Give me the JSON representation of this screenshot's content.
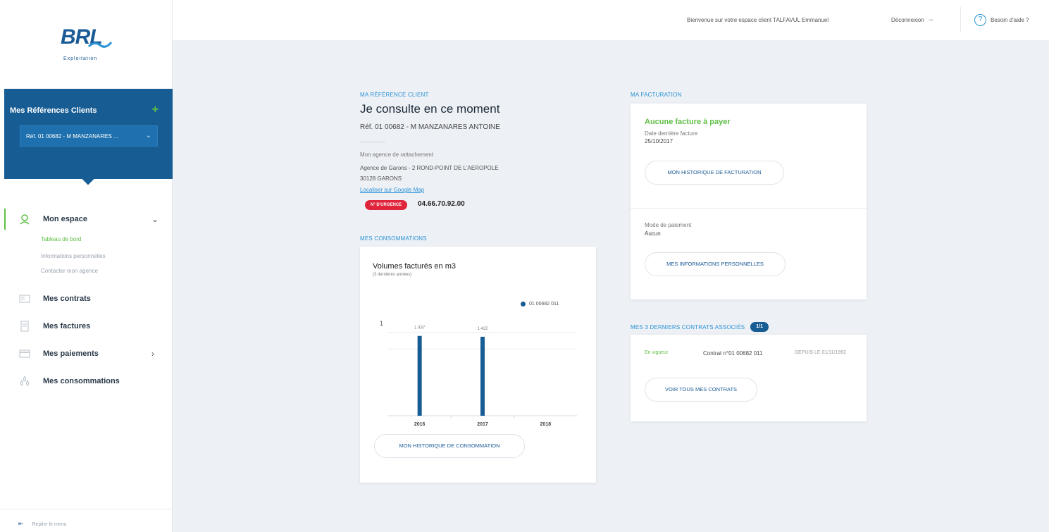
{
  "brand": {
    "logo_text": "BRL",
    "logo_sub": "Exploitation",
    "brand_blue": "#175d94",
    "accent_green": "#5fbf45",
    "accent_light_blue": "#2a93d5",
    "alert_red": "#e0243c"
  },
  "header": {
    "welcome": "Bienvenue sur votre espace client TALFAVUL Emmanuel",
    "logout": "Déconnexion",
    "help": "Besoin d'aide ?"
  },
  "sidebar": {
    "refs_title": "Mes Références Clients",
    "refs_add": "+",
    "refs_selected": "Réf. 01 00682 - M MANZANARES ...",
    "nav": [
      {
        "label": "Mon espace",
        "icon": "user-pin-icon"
      },
      {
        "label": "Mes contrats",
        "icon": "contract-icon"
      },
      {
        "label": "Mes factures",
        "icon": "invoice-icon"
      },
      {
        "label": "Mes paiements",
        "icon": "card-icon"
      },
      {
        "label": "Mes consommations",
        "icon": "drops-icon"
      }
    ],
    "subnav": [
      "Tableau de bord",
      "Informations personnelles",
      "Contacter mon agence"
    ],
    "collapse": "Replier le menu"
  },
  "client": {
    "section": "MA RÉFÉRENCE CLIENT",
    "heading": "Je consulte en ce moment",
    "ref": "Réf. 01 00682 - M MANZANARES ANTOINE",
    "agency_label": "Mon agence de rattachement",
    "agency_line1": "Agence de Garons - 2 ROND-POINT DE L'AEROPOLE",
    "agency_line2": "30128 GARONS",
    "agency_link": "Localiser sur Google Map",
    "urgence_label": "N° D'URGENCE",
    "urgence_number": "04.66.70.92.00"
  },
  "consumption": {
    "section": "MES CONSOMMATIONS",
    "title": "Volumes facturés en m3",
    "subtitle": "(3 dernières années)",
    "legend": "01 00682 011",
    "button": "MON HISTORIQUE DE CONSOMMATION"
  },
  "billing": {
    "section": "MA FACTURATION",
    "none": "Aucune facture à payer",
    "last_label": "Date dernière facture",
    "last_date": "25/10/2017",
    "history_button": "MON HISTORIQUE DE FACTURATION",
    "pay_label": "Mode de paiement",
    "pay_value": "Aucun",
    "info_button": "MES INFORMATIONS PERSONNELLES"
  },
  "contracts": {
    "section": "MES 3 DERNIERS CONTRATS ASSOCIÉS",
    "badge": "1/1",
    "status": "En vigueur",
    "number": "Contrat n°01 00682 011",
    "since": "DEPUIS LE 01/11/1992",
    "button": "VOIR TOUS MES CONTRATS"
  },
  "chart_data": {
    "type": "bar",
    "categories": [
      "2016",
      "2017",
      "2018"
    ],
    "series": [
      {
        "name": "01 00682 011",
        "values": [
          1437,
          1422,
          null
        ],
        "color": "#175d94"
      }
    ],
    "value_labels": [
      "1 437",
      "1 422",
      ""
    ],
    "ytick_label": "1",
    "title": "Volumes facturés en m3",
    "subtitle": "(3 dernières années)",
    "legend_position": "top-right",
    "grid": true,
    "ylim": [
      0,
      1700
    ]
  }
}
